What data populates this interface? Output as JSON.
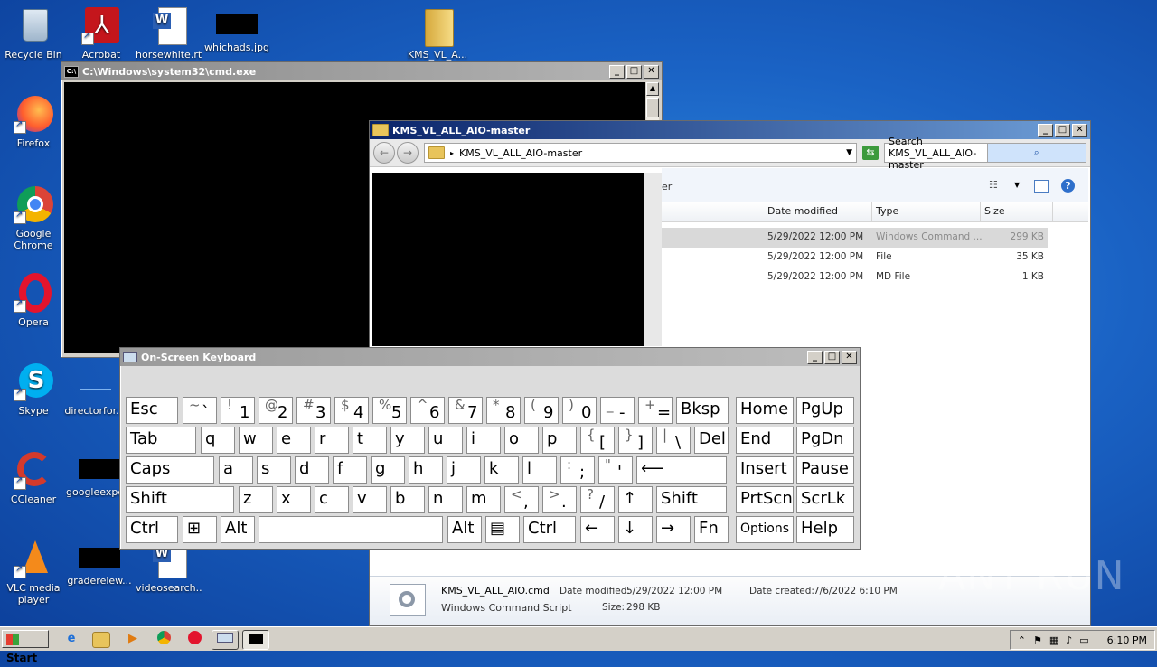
{
  "desktop": {
    "icons": [
      {
        "label": "Recycle Bin"
      },
      {
        "label": "Acrobat"
      },
      {
        "label": "horsewhite.rtf"
      },
      {
        "label": "whichads.jpg"
      },
      {
        "label": "KMS_VL_A..."
      },
      {
        "label": "Firefox"
      },
      {
        "label": "Google Chrome"
      },
      {
        "label": "Opera"
      },
      {
        "label": "Skype"
      },
      {
        "label": "directorfor..."
      },
      {
        "label": "CCleaner"
      },
      {
        "label": "googleexpe..."
      },
      {
        "label": "VLC media player"
      },
      {
        "label": "graderelew..."
      },
      {
        "label": "videosearch..."
      }
    ]
  },
  "cmd": {
    "title": "C:\\Windows\\system32\\cmd.exe",
    "icon": "cmd-icon"
  },
  "explorer": {
    "title": "KMS_VL_ALL_AIO-master",
    "address": "KMS_VL_ALL_AIO-master",
    "search_placeholder": "Search KMS_VL_ALL_AIO-master",
    "toolbar_fragment": "er",
    "columns": [
      "Date modified",
      "Type",
      "Size"
    ],
    "files": [
      {
        "date": "5/29/2022 12:00 PM",
        "type": "Windows Command ...",
        "size": "299 KB"
      },
      {
        "date": "5/29/2022 12:00 PM",
        "type": "File",
        "size": "35 KB"
      },
      {
        "date": "5/29/2022 12:00 PM",
        "type": "MD File",
        "size": "1 KB"
      }
    ],
    "details": {
      "filename": "KMS_VL_ALL_AIO.cmd",
      "modified_label": "Date modified:",
      "modified": "5/29/2022 12:00 PM",
      "created_label": "Date created:",
      "created": "7/6/2022 6:10 PM",
      "filetype": "Windows Command Script",
      "size_label": "Size:",
      "size": "298 KB"
    }
  },
  "osk": {
    "title": "On-Screen Keyboard",
    "rows": [
      [
        {
          "main": "Esc"
        },
        {
          "shift": "~",
          "low": "`"
        },
        {
          "shift": "!",
          "low": "1"
        },
        {
          "shift": "@",
          "low": "2"
        },
        {
          "shift": "#",
          "low": "3"
        },
        {
          "shift": "$",
          "low": "4"
        },
        {
          "shift": "%",
          "low": "5"
        },
        {
          "shift": "^",
          "low": "6"
        },
        {
          "shift": "&",
          "low": "7"
        },
        {
          "shift": "*",
          "low": "8"
        },
        {
          "shift": "(",
          "low": "9"
        },
        {
          "shift": ")",
          "low": "0"
        },
        {
          "shift": "_",
          "low": "-"
        },
        {
          "shift": "+",
          "low": "="
        },
        {
          "main": "Bksp"
        },
        {
          "main": "Home"
        },
        {
          "main": "PgUp"
        }
      ],
      [
        {
          "main": "Tab"
        },
        {
          "main": "q"
        },
        {
          "main": "w"
        },
        {
          "main": "e"
        },
        {
          "main": "r"
        },
        {
          "main": "t"
        },
        {
          "main": "y"
        },
        {
          "main": "u"
        },
        {
          "main": "i"
        },
        {
          "main": "o"
        },
        {
          "main": "p"
        },
        {
          "shift": "{",
          "low": "["
        },
        {
          "shift": "}",
          "low": "]"
        },
        {
          "shift": "|",
          "low": "\\"
        },
        {
          "main": "Del"
        },
        {
          "main": "End"
        },
        {
          "main": "PgDn"
        }
      ],
      [
        {
          "main": "Caps"
        },
        {
          "main": "a"
        },
        {
          "main": "s"
        },
        {
          "main": "d"
        },
        {
          "main": "f"
        },
        {
          "main": "g"
        },
        {
          "main": "h"
        },
        {
          "main": "j"
        },
        {
          "main": "k"
        },
        {
          "main": "l"
        },
        {
          "shift": ":",
          "low": ";"
        },
        {
          "shift": "\"",
          "low": "'"
        },
        {
          "main": "⟵"
        },
        {
          "main": "Insert"
        },
        {
          "main": "Pause"
        }
      ],
      [
        {
          "main": "Shift"
        },
        {
          "main": "z"
        },
        {
          "main": "x"
        },
        {
          "main": "c"
        },
        {
          "main": "v"
        },
        {
          "main": "b"
        },
        {
          "main": "n"
        },
        {
          "main": "m"
        },
        {
          "shift": "<",
          "low": ","
        },
        {
          "shift": ">",
          "low": "."
        },
        {
          "shift": "?",
          "low": "/"
        },
        {
          "main": "↑"
        },
        {
          "main": "Shift"
        },
        {
          "main": "PrtScn"
        },
        {
          "main": "ScrLk"
        }
      ],
      [
        {
          "main": "Ctrl"
        },
        {
          "main": "⊞"
        },
        {
          "main": "Alt"
        },
        {
          "main": ""
        },
        {
          "main": "Alt"
        },
        {
          "main": "▤"
        },
        {
          "main": "Ctrl"
        },
        {
          "main": "←"
        },
        {
          "main": "↓"
        },
        {
          "main": "→"
        },
        {
          "main": "Fn"
        },
        {
          "main": "Options"
        },
        {
          "main": "Help"
        }
      ]
    ]
  },
  "taskbar": {
    "start_label": "Start",
    "clock": "6:10 PM"
  },
  "watermark": "ANY RUN"
}
